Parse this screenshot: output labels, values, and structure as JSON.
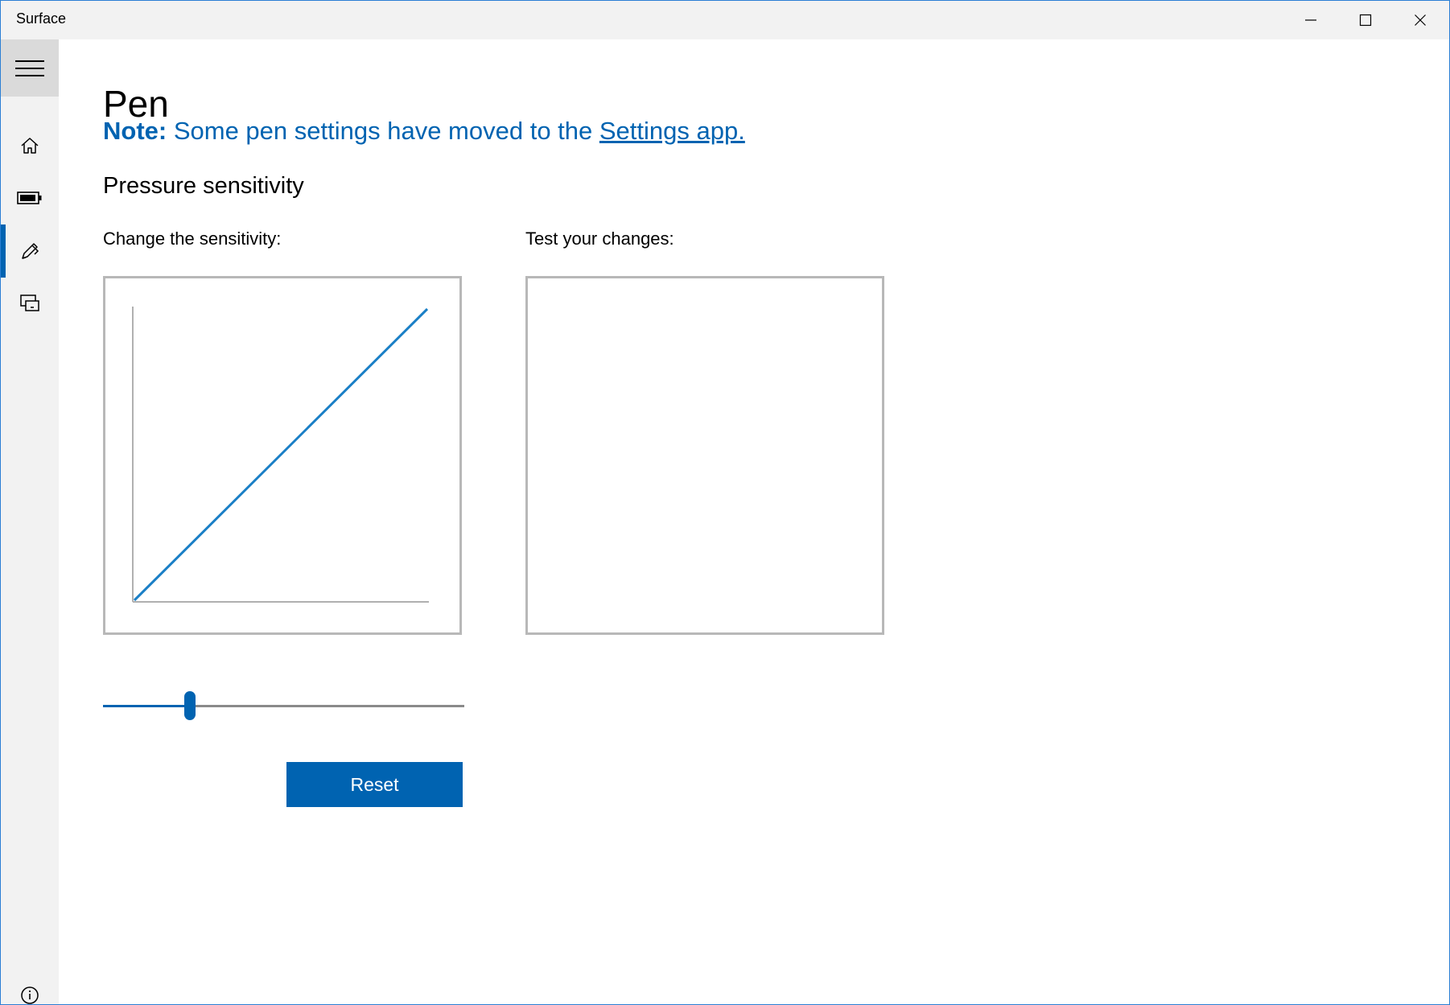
{
  "window": {
    "title": "Surface",
    "controls": [
      "minimize",
      "maximize",
      "close"
    ]
  },
  "sidebar": {
    "items": [
      {
        "id": "home",
        "icon": "home-icon"
      },
      {
        "id": "battery",
        "icon": "battery-icon"
      },
      {
        "id": "pen",
        "icon": "pen-icon",
        "active": true
      },
      {
        "id": "device",
        "icon": "device-icon"
      }
    ],
    "footer_icon": "info-icon"
  },
  "page": {
    "title": "Pen",
    "note_bold": "Note:",
    "note_text": " Some pen settings have moved to the ",
    "note_link": "Settings app."
  },
  "pressure": {
    "heading": "Pressure sensitivity",
    "change_label": "Change the sensitivity:",
    "test_label": "Test your changes:",
    "slider_value_percent": 24,
    "reset_label": "Reset"
  },
  "colors": {
    "accent": "#0063b1",
    "curve": "#1a7fc6",
    "border": "#b8b8b8"
  }
}
